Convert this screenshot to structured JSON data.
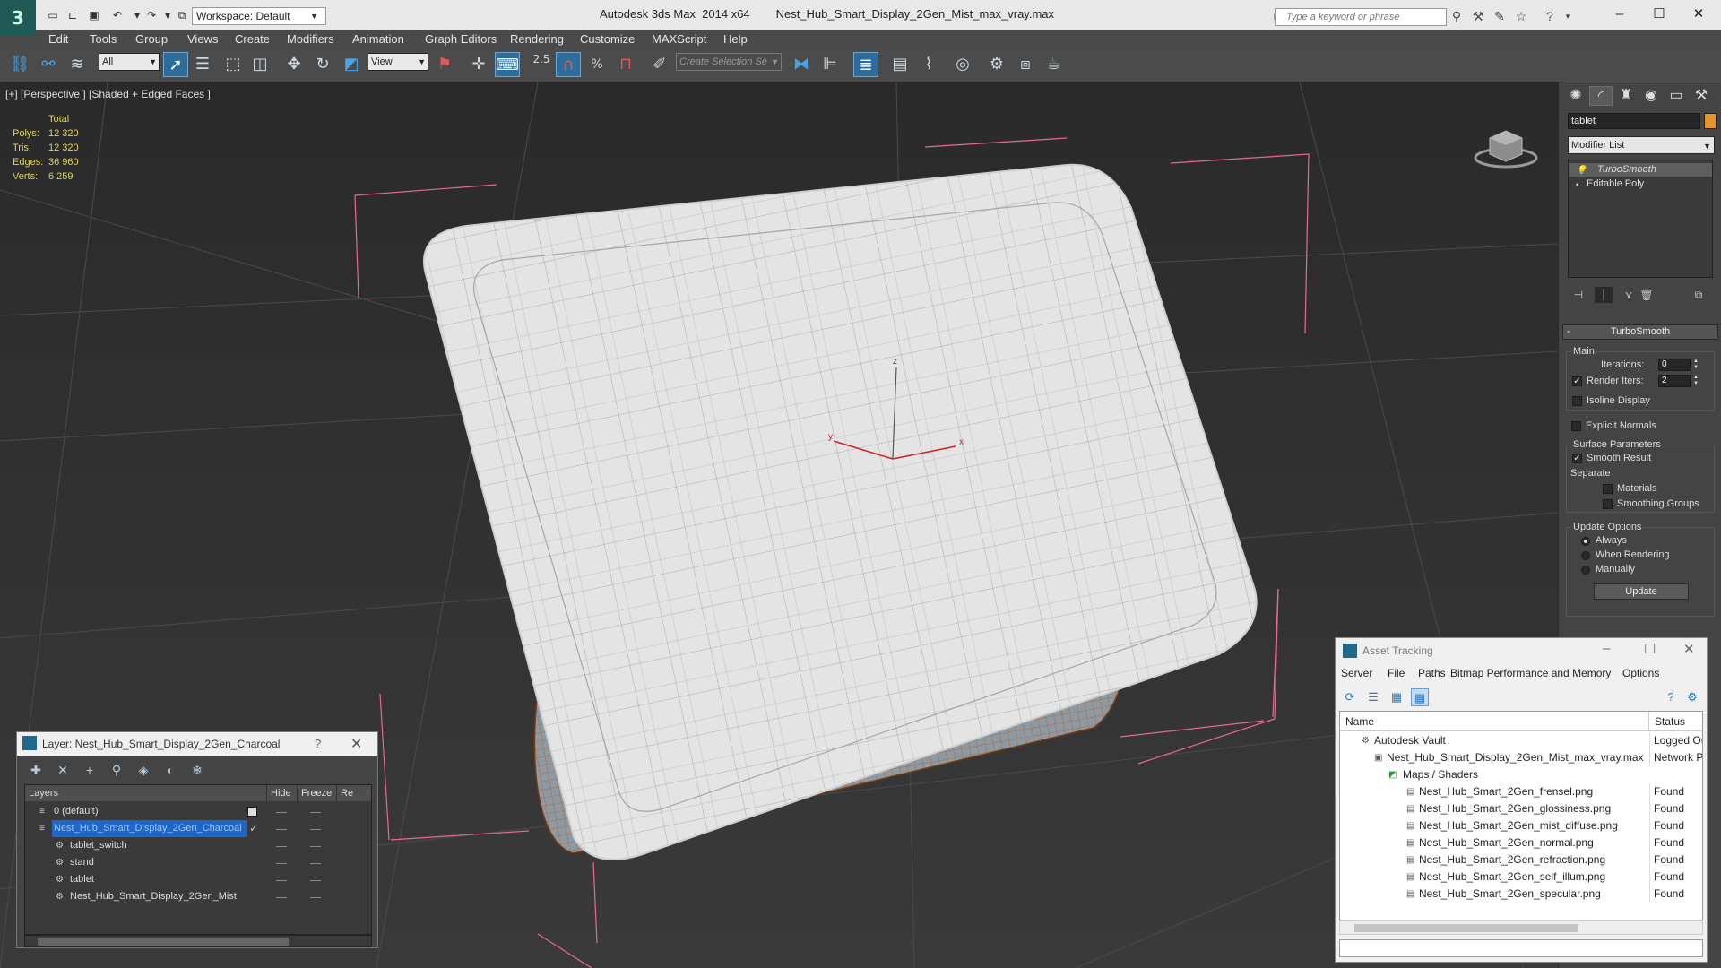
{
  "app": {
    "title": "Autodesk 3ds Max  2014 x64",
    "file": "Nest_Hub_Smart_Display_2Gen_Mist_max_vray.max",
    "workspace": "Workspace: Default",
    "search_placeholder": "Type a keyword or phrase"
  },
  "menu": [
    "Edit",
    "Tools",
    "Group",
    "Views",
    "Create",
    "Modifiers",
    "Animation",
    "Graph Editors",
    "Rendering",
    "Customize",
    "MAXScript",
    "Help"
  ],
  "toolbar": {
    "filter": "All",
    "ref_coord": "View",
    "snap_angle": "2.5",
    "selection_set": "Create Selection Se"
  },
  "viewport": {
    "label": "[+] [Perspective ] [Shaded + Edged Faces ]",
    "stats": {
      "header": "Total",
      "rows": [
        {
          "label": "Polys:",
          "value": "12 320"
        },
        {
          "label": "Tris:",
          "value": "12 320"
        },
        {
          "label": "Edges:",
          "value": "36 960"
        },
        {
          "label": "Verts:",
          "value": "6 259"
        }
      ]
    },
    "gizmo": {
      "x": "x",
      "y": "y",
      "z": "z"
    }
  },
  "command_panel": {
    "object_name": "tablet",
    "object_color": "#e5922a",
    "modifier_list": "Modifier List",
    "stack": [
      "TurboSmooth",
      "Editable Poly"
    ],
    "rollout": {
      "title": "TurboSmooth",
      "main": "Main",
      "iterations_label": "Iterations:",
      "iterations": "0",
      "render_iters_label": "Render Iters:",
      "render_iters": "2",
      "render_iters_checked": true,
      "isoline": "Isoline Display",
      "explicit_normals": "Explicit Normals",
      "surface_params": "Surface Parameters",
      "smooth_result": "Smooth Result",
      "separate": "Separate",
      "materials": "Materials",
      "smoothing_groups": "Smoothing Groups",
      "update_options": "Update Options",
      "always": "Always",
      "when_rendering": "When Rendering",
      "manually": "Manually",
      "update_button": "Update"
    }
  },
  "layer_dialog": {
    "title": "Layer: Nest_Hub_Smart_Display_2Gen_Charcoal",
    "help": "?",
    "columns": [
      "Layers",
      "Hide",
      "Freeze",
      "Re"
    ],
    "rows": [
      {
        "name": "0 (default)",
        "indent": 0,
        "selected": false
      },
      {
        "name": "Nest_Hub_Smart_Display_2Gen_Charcoal",
        "indent": 0,
        "selected": true
      },
      {
        "name": "tablet_switch",
        "indent": 1,
        "selected": false
      },
      {
        "name": "stand",
        "indent": 1,
        "selected": false
      },
      {
        "name": "tablet",
        "indent": 1,
        "selected": false
      },
      {
        "name": "Nest_Hub_Smart_Display_2Gen_Mist",
        "indent": 1,
        "selected": false
      }
    ]
  },
  "asset_tracking": {
    "title": "Asset Tracking",
    "menu": [
      "Server",
      "File",
      "Paths",
      "Bitmap Performance and Memory",
      "Options"
    ],
    "columns": [
      "Name",
      "Status"
    ],
    "rows": [
      {
        "name": "Autodesk Vault",
        "status": "Logged Ou",
        "level": 0
      },
      {
        "name": "Nest_Hub_Smart_Display_2Gen_Mist_max_vray.max",
        "status": "Network Pa",
        "level": 1
      },
      {
        "name": "Maps / Shaders",
        "status": "",
        "level": 2
      },
      {
        "name": "Nest_Hub_Smart_2Gen_frensel.png",
        "status": "Found",
        "level": 3
      },
      {
        "name": "Nest_Hub_Smart_2Gen_glossiness.png",
        "status": "Found",
        "level": 3
      },
      {
        "name": "Nest_Hub_Smart_2Gen_mist_diffuse.png",
        "status": "Found",
        "level": 3
      },
      {
        "name": "Nest_Hub_Smart_2Gen_normal.png",
        "status": "Found",
        "level": 3
      },
      {
        "name": "Nest_Hub_Smart_2Gen_refraction.png",
        "status": "Found",
        "level": 3
      },
      {
        "name": "Nest_Hub_Smart_2Gen_self_illum.png",
        "status": "Found",
        "level": 3
      },
      {
        "name": "Nest_Hub_Smart_2Gen_specular.png",
        "status": "Found",
        "level": 3
      }
    ]
  }
}
